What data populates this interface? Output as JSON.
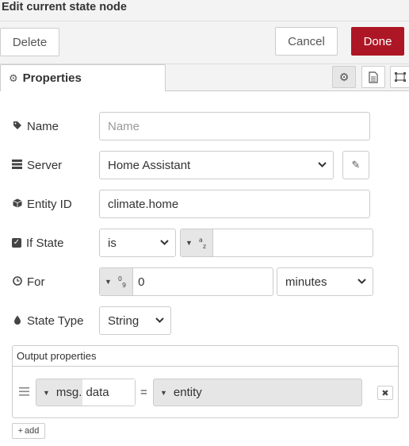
{
  "dialog": {
    "title": "Edit current state node"
  },
  "buttons": {
    "delete": "Delete",
    "cancel": "Cancel",
    "done": "Done",
    "add": "add"
  },
  "tabs": {
    "properties": "Properties"
  },
  "fields": {
    "name": {
      "label": "Name",
      "placeholder": "Name",
      "value": ""
    },
    "server": {
      "label": "Server",
      "value": "Home Assistant"
    },
    "entity_id": {
      "label": "Entity ID",
      "value": "climate.home"
    },
    "if_state": {
      "label": "If State",
      "operator": "is",
      "value": ""
    },
    "for": {
      "label": "For",
      "value": "0",
      "unit": "minutes"
    },
    "state_type": {
      "label": "State Type",
      "value": "String"
    }
  },
  "output": {
    "header": "Output properties",
    "rows": [
      {
        "prefix": "msg.",
        "property": "data",
        "equals": "=",
        "value": "entity"
      }
    ]
  },
  "colors": {
    "done": "#ad1625",
    "border": "#cccccc",
    "toolbar": "#f3f3f3"
  },
  "icons": [
    "gear-icon",
    "document-icon",
    "frame-icon",
    "tag-icon",
    "server-icon",
    "cube-icon",
    "checkbox-icon",
    "clock-icon",
    "drop-icon",
    "pencil-icon",
    "drag-handle-icon",
    "close-icon",
    "plus-icon",
    "chevron-down-icon",
    "caret-down-icon"
  ]
}
